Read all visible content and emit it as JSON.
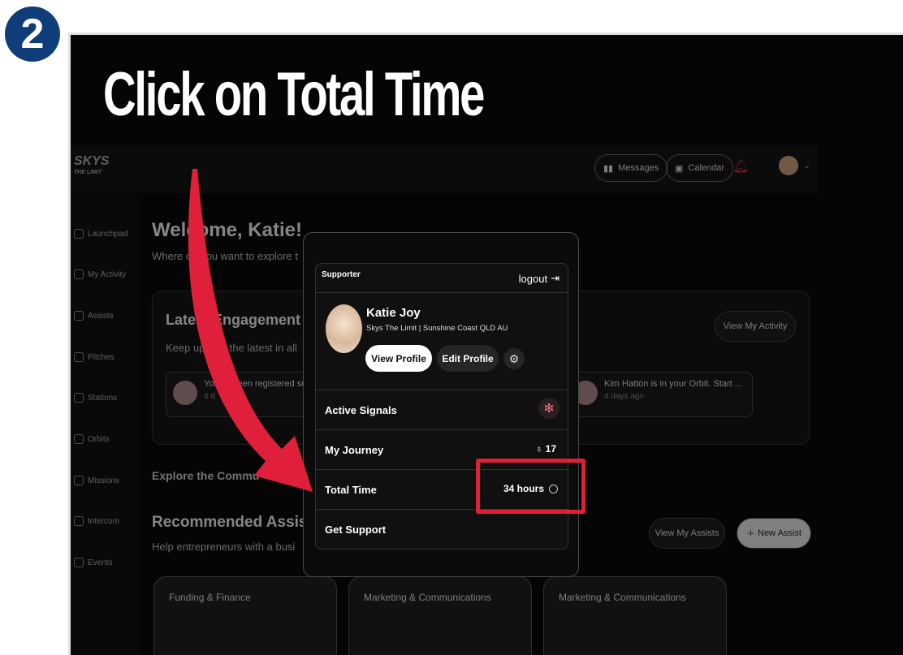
{
  "step_number": "2",
  "instruction": "Click on Total Time",
  "app": {
    "logo": "SKYS",
    "logo_sub": "THE LIMIT",
    "header": {
      "messages_label": "Messages",
      "calendar_label": "Calendar"
    },
    "sidebar": {
      "items": [
        {
          "label": "Launchpad"
        },
        {
          "label": "My Activity"
        },
        {
          "label": "Assists"
        },
        {
          "label": "Pitches"
        },
        {
          "label": "Stations"
        },
        {
          "label": "Orbits"
        },
        {
          "label": "Missions"
        },
        {
          "label": "Intercom"
        },
        {
          "label": "Events"
        }
      ]
    },
    "main": {
      "welcome": "Welcome, Katie!",
      "subwelcome": "Where do you want to explore t",
      "latest_title": "Latest Engagement",
      "latest_sub": "Keep up with the latest in all",
      "view_activity_label": "View My Activity",
      "notif1": {
        "title": "You've been registered succ",
        "sub": "4 d"
      },
      "notif2": {
        "title": "Kim Hatton is in your Orbit. Start ...",
        "sub": "4 days ago"
      },
      "explore": "Explore the Commu",
      "recommended": "Recommended Assists",
      "help": "Help entrepreneurs with a busi",
      "view_assists_label": "View My Assists",
      "new_assist_label": "New Assist",
      "cards": [
        {
          "label": "Funding & Finance"
        },
        {
          "label": "Marketing & Communications"
        },
        {
          "label": "Marketing & Communications"
        }
      ]
    }
  },
  "popup": {
    "role": "Supporter",
    "logout_label": "logout",
    "name": "Katie Joy",
    "org": "Skys The Limit | Sunshine Coast QLD AU",
    "view_profile_label": "View Profile",
    "edit_profile_label": "Edit Profile",
    "active_signals_label": "Active Signals",
    "my_journey_label": "My Journey",
    "my_journey_value": "17",
    "total_time_label": "Total Time",
    "total_time_value": "34 hours",
    "get_support_label": "Get Support"
  },
  "colors": {
    "highlight": "#e0203a",
    "badge": "#0f3d7a",
    "arrow": "#e0203a"
  }
}
